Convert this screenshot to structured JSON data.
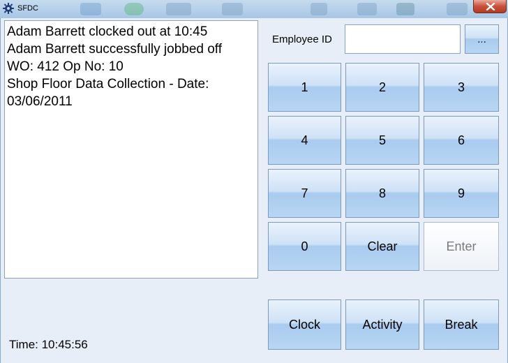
{
  "window": {
    "title": "SFDC"
  },
  "log": {
    "lines": [
      "Adam Barrett clocked out at 10:45",
      "Adam Barrett successfully jobbed off",
      "WO: 412 Op No: 10",
      "Shop Floor Data Collection - Date:",
      "03/06/2011"
    ]
  },
  "status": {
    "time_label": "Time: 10:45:56"
  },
  "employee": {
    "label": "Employee ID",
    "value": "",
    "browse_label": "..."
  },
  "keypad": {
    "keys": [
      "1",
      "2",
      "3",
      "4",
      "5",
      "6",
      "7",
      "8",
      "9",
      "0",
      "Clear",
      "Enter"
    ]
  },
  "actions": {
    "clock": "Clock",
    "activity": "Activity",
    "break": "Break"
  },
  "colors": {
    "button_face": "#b8d6f4",
    "close_button": "#c9503a",
    "disabled_text": "#7a7a7a"
  }
}
